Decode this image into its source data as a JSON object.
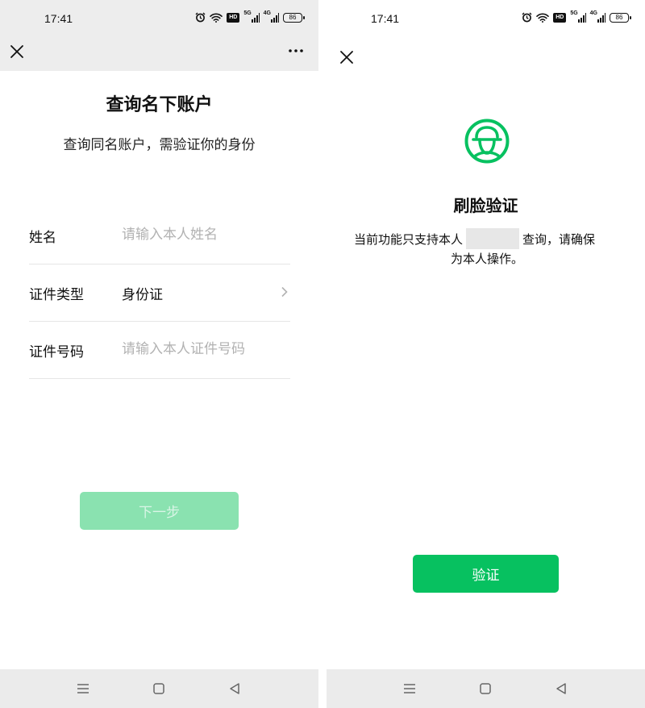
{
  "left_screen": {
    "status_bar": {
      "time": "17:41",
      "hd_label": "HD",
      "net1_label": "5G",
      "net2_label": "4G",
      "battery": "86"
    },
    "nav": {
      "close_icon": "close-icon",
      "more_icon": "more-dots-icon"
    },
    "title": "查询名下账户",
    "subtitle": "查询同名账户，需验证你的身份",
    "form": {
      "name": {
        "label": "姓名",
        "placeholder": "请输入本人姓名"
      },
      "id_type": {
        "label": "证件类型",
        "value": "身份证"
      },
      "id_number": {
        "label": "证件号码",
        "placeholder": "请输入本人证件号码"
      }
    },
    "next_button": "下一步",
    "colors": {
      "nav_bg": "#ededed",
      "button_disabled": "#8ae2b0"
    }
  },
  "right_screen": {
    "status_bar": {
      "time": "17:41",
      "hd_label": "HD",
      "net1_label": "5G",
      "net2_label": "4G",
      "battery": "86"
    },
    "nav": {
      "close_icon": "close-icon"
    },
    "logo_icon": "face-verify-icon",
    "title": "刷脸验证",
    "description_prefix": "当前功能只支持本人",
    "description_suffix": "查询，请确保",
    "description_line2": "为本人操作。",
    "verify_button": "验证",
    "colors": {
      "brand_green": "#07c160"
    }
  },
  "system_nav": {
    "menu_icon": "menu-icon",
    "home_icon": "home-icon",
    "back_icon": "back-icon"
  }
}
